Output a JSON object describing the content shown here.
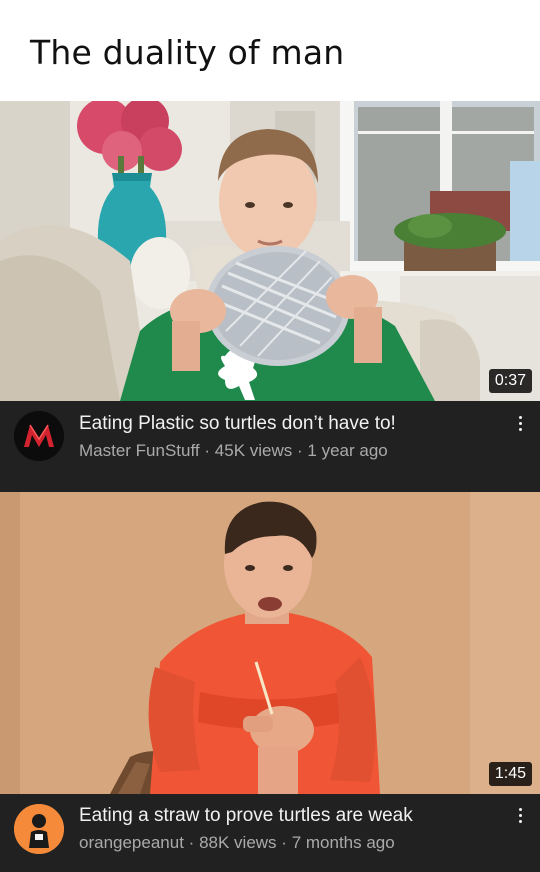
{
  "caption": "The duality of man",
  "videos": [
    {
      "title": "Eating Plastic so turtles don’t have to!",
      "channel": "Master FunStuff",
      "views": "45K views",
      "age": "1 year ago",
      "duration": "0:37",
      "avatar_letter": "M",
      "avatar_bg": "#0c0c0c",
      "avatar_fg": "#d3232f"
    },
    {
      "title": "Eating a straw to prove turtles are weak",
      "channel": "orangepeanut",
      "views": "88K views",
      "age": "7 months ago",
      "duration": "1:45",
      "avatar_bg": "#f48a3a"
    }
  ],
  "separator": "·",
  "colors": {
    "card_bg": "#212121",
    "title_text": "#f1f1f1",
    "meta_text": "#aaaaaa"
  }
}
